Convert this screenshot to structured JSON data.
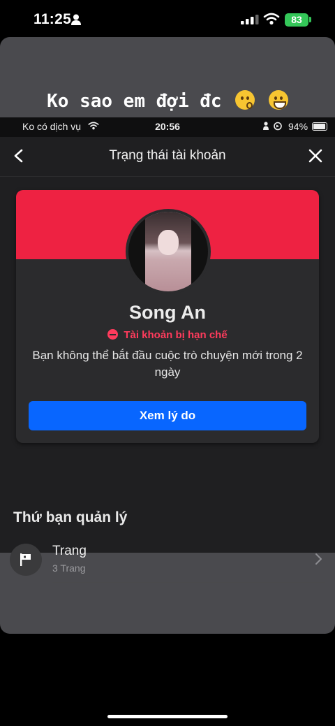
{
  "device_status": {
    "time": "11:25",
    "battery": "83"
  },
  "story": {
    "caption": "Ko sao em đợi đc",
    "emojis": [
      "kissing-face",
      "grinning-face"
    ]
  },
  "inner_status": {
    "carrier": "Ko có dịch vụ",
    "time": "20:56",
    "battery": "94%"
  },
  "nav": {
    "title": "Trạng thái tài khoản"
  },
  "account_card": {
    "name": "Song An",
    "status": "Tài khoản bị hạn chế",
    "description": "Bạn không thể bắt đầu cuộc trò chuyện mới trong 2 ngày",
    "button_label": "Xem lý do"
  },
  "manage_section": {
    "title": "Thứ bạn quản lý",
    "items": [
      {
        "title": "Trang",
        "subtitle": "3 Trang",
        "icon": "flag-icon"
      }
    ]
  },
  "colors": {
    "banner": "#ee2242",
    "restricted_text": "#ff3b5c",
    "button": "#0866ff",
    "battery": "#34c759"
  }
}
